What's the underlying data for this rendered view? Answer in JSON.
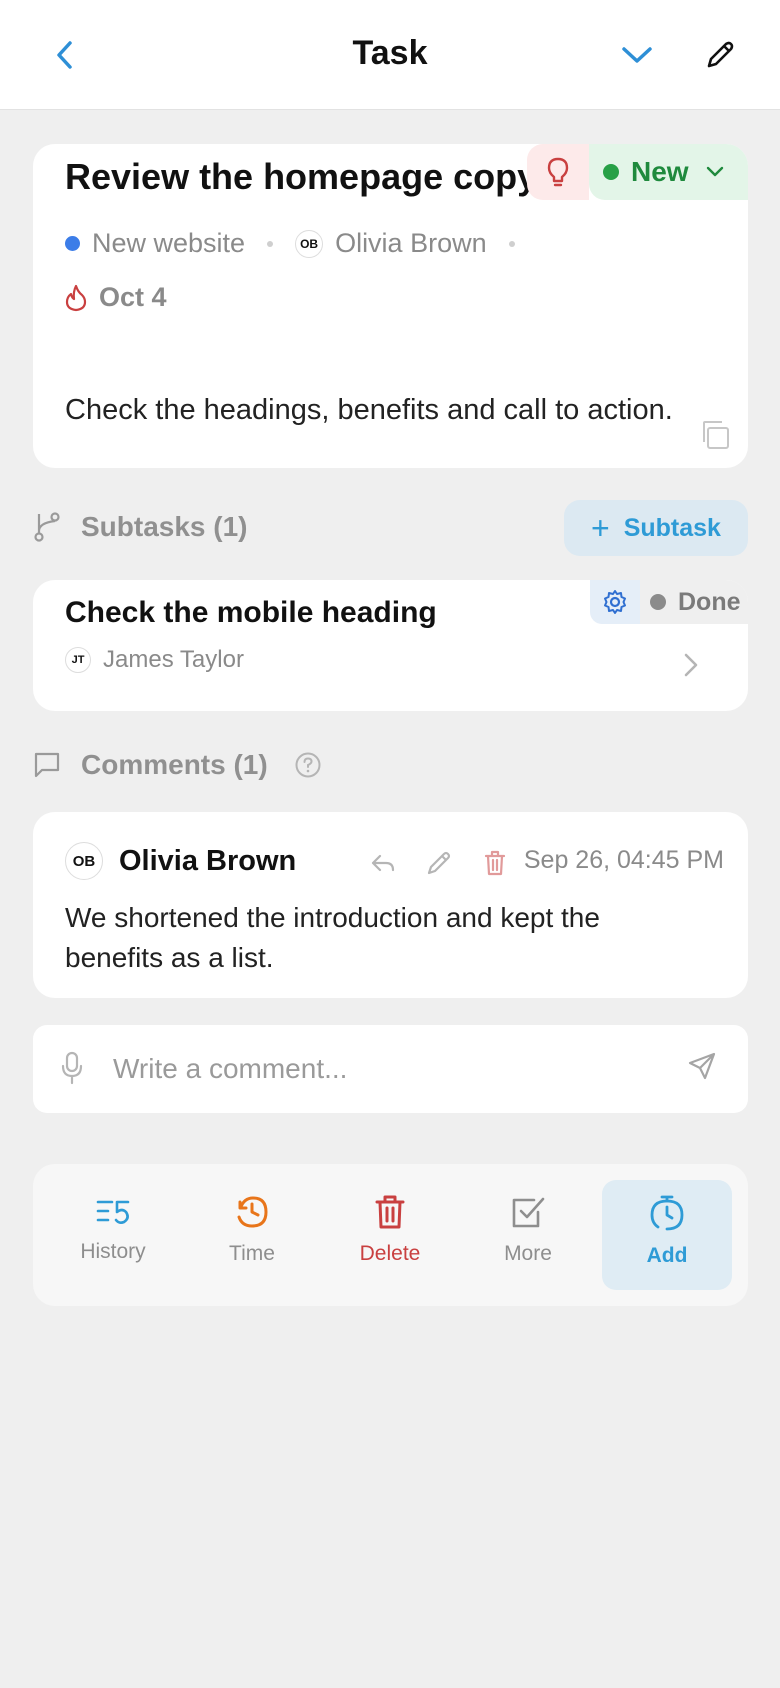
{
  "header": {
    "title": "Task"
  },
  "task": {
    "title": "Review the homepage copy",
    "status": "New",
    "project": "New website",
    "assignee_initials": "OB",
    "assignee": "Olivia Brown",
    "due": "Oct 4",
    "description": "Check the headings, benefits and call to action."
  },
  "subtasks": {
    "heading": "Subtasks (1)",
    "add_label": "Subtask",
    "items": [
      {
        "title": "Check the mobile heading",
        "status": "Done",
        "assignee_initials": "JT",
        "assignee": "James Taylor"
      }
    ]
  },
  "comments": {
    "heading": "Comments (1)",
    "items": [
      {
        "author_initials": "OB",
        "author": "Olivia Brown",
        "time": "Sep 26, 04:45 PM",
        "text": "We shortened the introduction and kept the benefits as a list."
      }
    ],
    "input_placeholder": "Write a comment..."
  },
  "toolbar": {
    "history": "History",
    "time": "Time",
    "delete": "Delete",
    "more": "More",
    "add": "Add"
  },
  "colors": {
    "accent": "#2e9bd6",
    "status_new": "#27a046",
    "danger": "#c94040",
    "time": "#e8751a"
  }
}
